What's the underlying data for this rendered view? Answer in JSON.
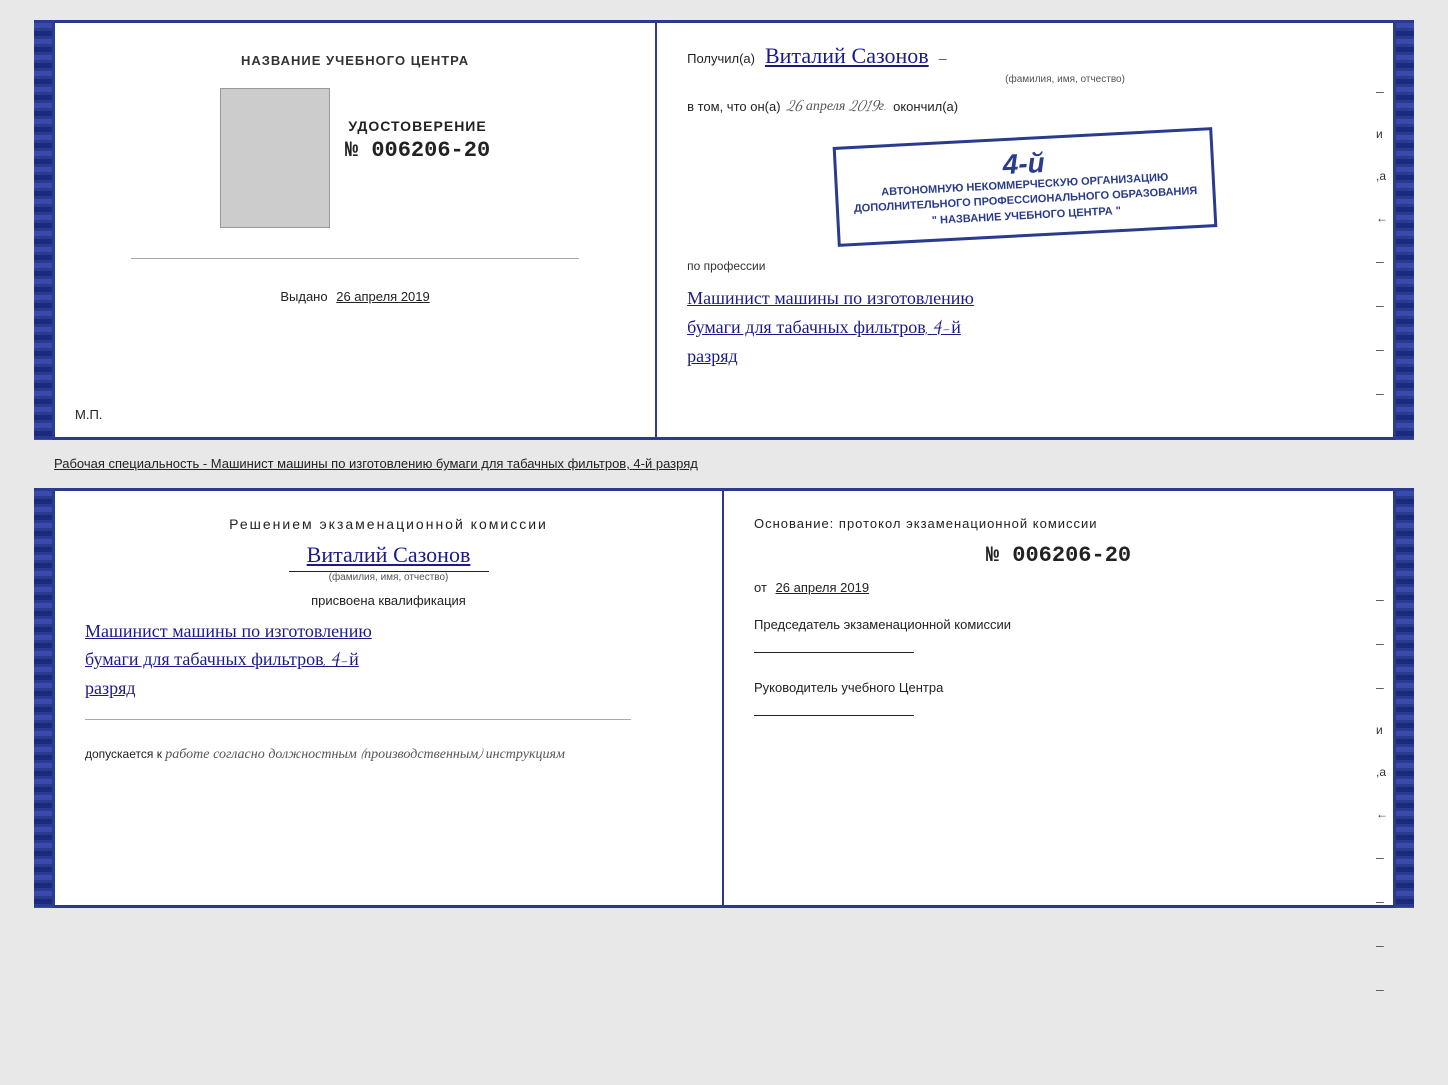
{
  "top_cert": {
    "left": {
      "training_center_label": "НАЗВАНИЕ УЧЕБНОГО ЦЕНТРА",
      "photo_alt": "Фото",
      "udostoverenie_title": "УДОСТОВЕРЕНИЕ",
      "udostoverenie_number": "№ 006206-20",
      "vydano_label": "Выдано",
      "vydano_date": "26 апреля 2019",
      "mp_label": "М.П."
    },
    "right": {
      "poluchil_label": "Получил(а)",
      "recipient_name": "Виталий Сазонов",
      "fio_hint": "(фамилия, имя, отчество)",
      "dash": "–",
      "v_tom_label": "в том, что он(а)",
      "date_handwritten": "26 апреля 2019г.",
      "okonchil_label": "окончил(а)",
      "stamp_number": "4-й",
      "stamp_line1": "АВТОНОМНУЮ НЕКОММЕРЧЕСКУЮ ОРГАНИЗАЦИЮ",
      "stamp_line2": "ДОПОЛНИТЕЛЬНОГО ПРОФЕССИОНАЛЬНОГО ОБРАЗОВАНИЯ",
      "stamp_line3": "\" НАЗВАНИЕ УЧЕБНОГО ЦЕНТРА \"",
      "po_professii_label": "по профессии",
      "profession_line1": "Машинист машины по изготовлению",
      "profession_line2": "бумаги для табачных фильтров, 4-й",
      "profession_line3": "разряд",
      "side_labels": [
        "–",
        "и",
        ",а",
        "←",
        "–",
        "–",
        "–",
        "–"
      ]
    }
  },
  "specialty_text": "Рабочая специальность - Машинист машины по изготовлению бумаги для табачных фильтров, 4-й разряд",
  "bottom_cert": {
    "left": {
      "resheniem_text": "Решением  экзаменационной  комиссии",
      "name": "Виталий Сазонов",
      "fio_hint": "(фамилия, имя, отчество)",
      "prisvoena_text": "присвоена квалификация",
      "qualification_line1": "Машинист машины по изготовлению",
      "qualification_line2": "бумаги для табачных фильтров, 4-й",
      "qualification_line3": "разряд",
      "dopuskaetsya_label": "допускается к",
      "dopuskaetsya_text": "работе согласно должностным (производственным) инструкциям"
    },
    "right": {
      "osnovanie_text": "Основание:  протокол  экзаменационной  комиссии",
      "protocol_number": "№  006206-20",
      "ot_label": "от",
      "ot_date": "26 апреля 2019",
      "chairman_label": "Председатель экзаменационной комиссии",
      "rukovoditel_label": "Руководитель учебного Центра",
      "side_labels": [
        "–",
        "–",
        "–",
        "и",
        ",а",
        "←",
        "–",
        "–",
        "–",
        "–"
      ]
    }
  }
}
